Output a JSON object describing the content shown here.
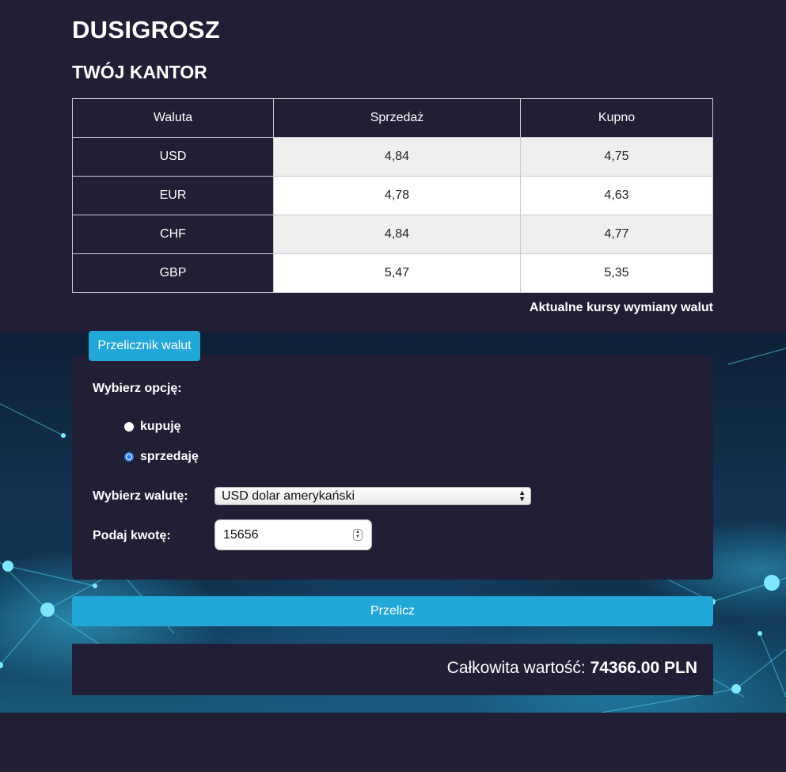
{
  "header": {
    "brand": "DUSIGROSZ",
    "subtitle": "TWÓJ KANTOR"
  },
  "rates_table": {
    "columns": [
      "Waluta",
      "Sprzedaż",
      "Kupno"
    ],
    "rows": [
      {
        "currency": "USD",
        "sell": "4,84",
        "buy": "4,75"
      },
      {
        "currency": "EUR",
        "sell": "4,78",
        "buy": "4,63"
      },
      {
        "currency": "CHF",
        "sell": "4,84",
        "buy": "4,77"
      },
      {
        "currency": "GBP",
        "sell": "5,47",
        "buy": "5,35"
      }
    ],
    "caption": "Aktualne kursy wymiany walut"
  },
  "converter": {
    "tab_label": "Przelicznik walut",
    "option_label": "Wybierz opcję:",
    "options": [
      {
        "label": "kupuję",
        "checked": false
      },
      {
        "label": "sprzedaję",
        "checked": true
      }
    ],
    "currency_label": "Wybierz walutę:",
    "currency_selected": "USD dolar amerykański",
    "amount_label": "Podaj kwotę:",
    "amount_value": "15656",
    "submit_label": "Przelicz"
  },
  "result": {
    "label": "Całkowita wartość:",
    "value": "74366.00 PLN"
  },
  "colors": {
    "background": "#201f36",
    "accent": "#22a8d8",
    "radio_checked": "#2f7de6"
  }
}
